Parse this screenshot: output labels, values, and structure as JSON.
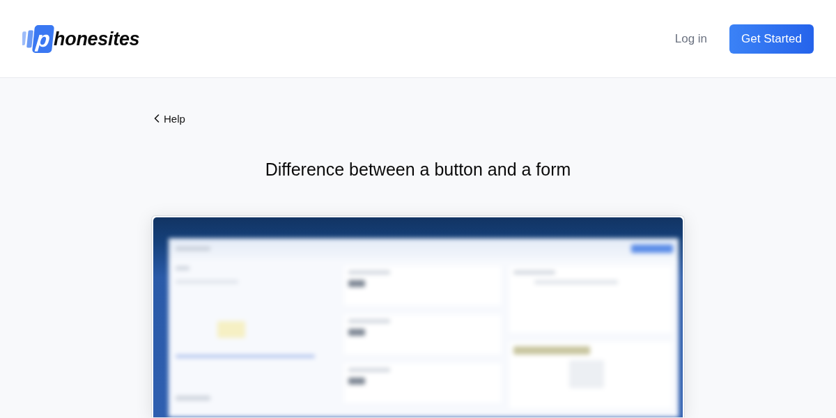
{
  "header": {
    "logo": {
      "mark_letter": "p",
      "wordmark": "honesites"
    },
    "nav": [
      {
        "label": "Log in",
        "kind": "link"
      },
      {
        "label": "Get Started",
        "kind": "button"
      }
    ]
  },
  "breadcrumb": {
    "back_label": "Help"
  },
  "article": {
    "title": "Difference between a button and a form"
  }
}
